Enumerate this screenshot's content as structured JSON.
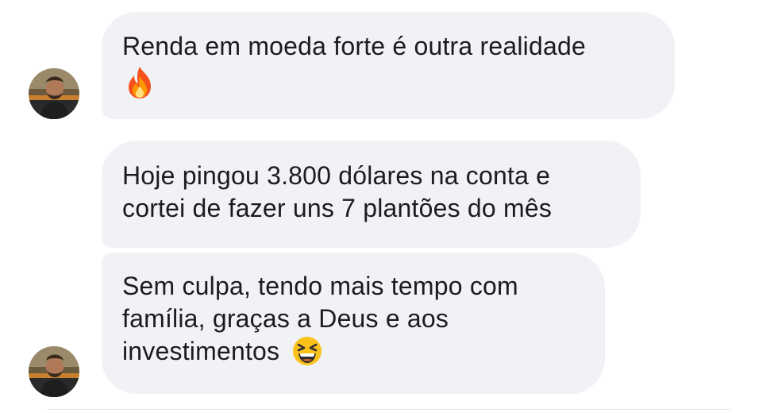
{
  "thread": {
    "messages": [
      {
        "lines": [
          "Renda em moeda forte é outra realidade"
        ],
        "emoji": "fire-emoji"
      },
      {
        "lines": [
          "Hoje pingou 3.800 dólares na conta e",
          "cortei de fazer uns 7 plantões do mês"
        ]
      },
      {
        "lines": [
          "Sem culpa, tendo mais tempo com",
          "família, graças a Deus e aos",
          "investimentos"
        ],
        "emoji": "grinning-squinting-face-emoji"
      }
    ],
    "avatar": {
      "icon": "user-avatar"
    }
  },
  "colors": {
    "bubble": "#f0f2f5",
    "text": "#1c1c1e",
    "background": "#ffffff"
  }
}
